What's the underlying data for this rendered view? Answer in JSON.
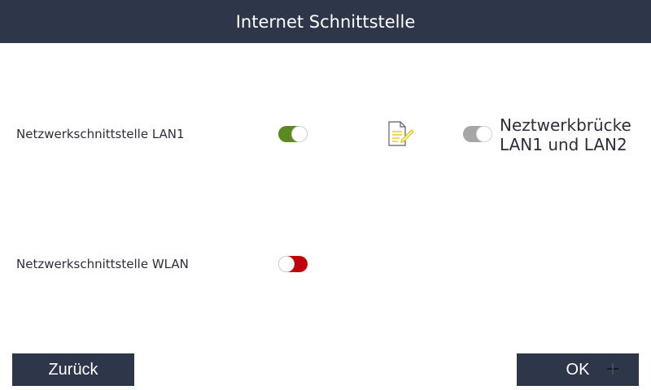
{
  "header": {
    "title": "Internet Schnittstelle"
  },
  "lan1": {
    "label": "Netzwerkschnittstelle LAN1",
    "toggle_state": "on",
    "toggle_color": "#5c8a22"
  },
  "wlan": {
    "label": "Netzwerkschnittstelle WLAN",
    "toggle_state": "off",
    "toggle_color": "#c0000b"
  },
  "bridge": {
    "label_line1": "Neztwerkbrücke",
    "label_line2": "LAN1 und LAN2",
    "toggle_state": "on",
    "toggle_color": "#a6a6a6",
    "icon": "document-edit-icon",
    "icon_color": "#e6c600"
  },
  "footer": {
    "back_label": "Zurück",
    "ok_label": "OK"
  },
  "colors": {
    "header_bg": "#2e3649",
    "button_bg": "#2e3649"
  }
}
